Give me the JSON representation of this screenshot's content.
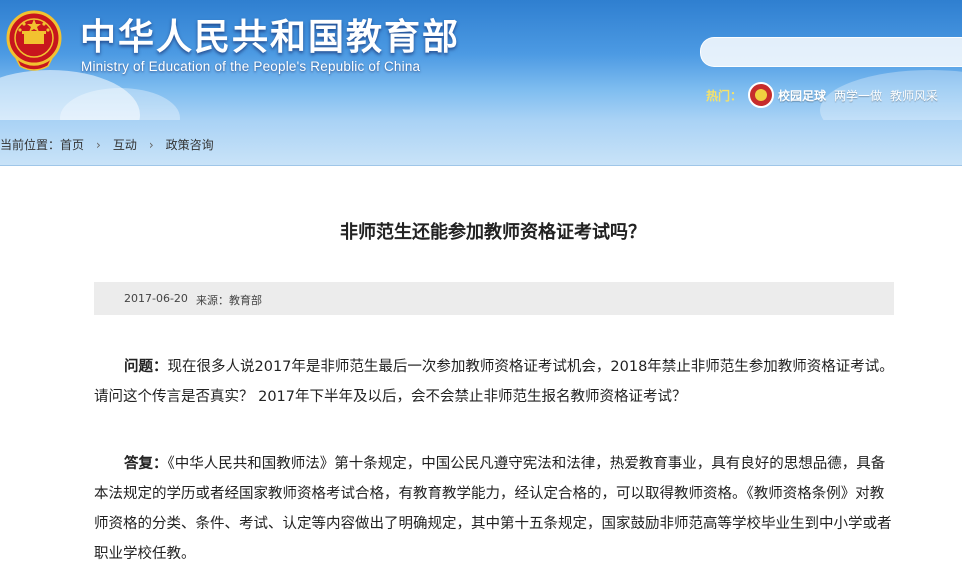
{
  "header": {
    "title": "中华人民共和国教育部",
    "subtitle": "Ministry of Education of the People's Republic of China",
    "search_placeholder": "",
    "hot_label": "热门：",
    "hot_links": [
      "校园足球",
      "两学一做",
      "教师风采"
    ]
  },
  "breadcrumb": {
    "prefix": "当前位置：",
    "items": [
      "首页",
      "互动",
      "政策咨询"
    ]
  },
  "article": {
    "title": "非师范生还能参加教师资格证考试吗？",
    "date": "2017-06-20",
    "source": "来源：教育部",
    "question_label": "问题：",
    "question_text": "现在很多人说2017年是非师范生最后一次参加教师资格证考试机会，2018年禁止非师范生参加教师资格证考试。请问这个传言是否真实？ 2017年下半年及以后，会不会禁止非师范生报名教师资格证考试？",
    "answer_label": "答复：",
    "answer_text": "《中华人民共和国教师法》第十条规定，中国公民凡遵守宪法和法律，热爱教育事业，具有良好的思想品德，具备本法规定的学历或者经国家教师资格考试合格，有教育教学能力，经认定合格的，可以取得教师资格。《教师资格条例》对教师资格的分类、条件、考试、认定等内容做出了明确规定，其中第十五条规定，国家鼓励非师范高等学校毕业生到中小学或者职业学校任教。"
  },
  "colors": {
    "header_blue": "#2f7fd0",
    "emblem_red": "#c8161d",
    "emblem_gold": "#f2c230",
    "hot_label": "#f5e26a",
    "meta_bg": "#ececec"
  }
}
